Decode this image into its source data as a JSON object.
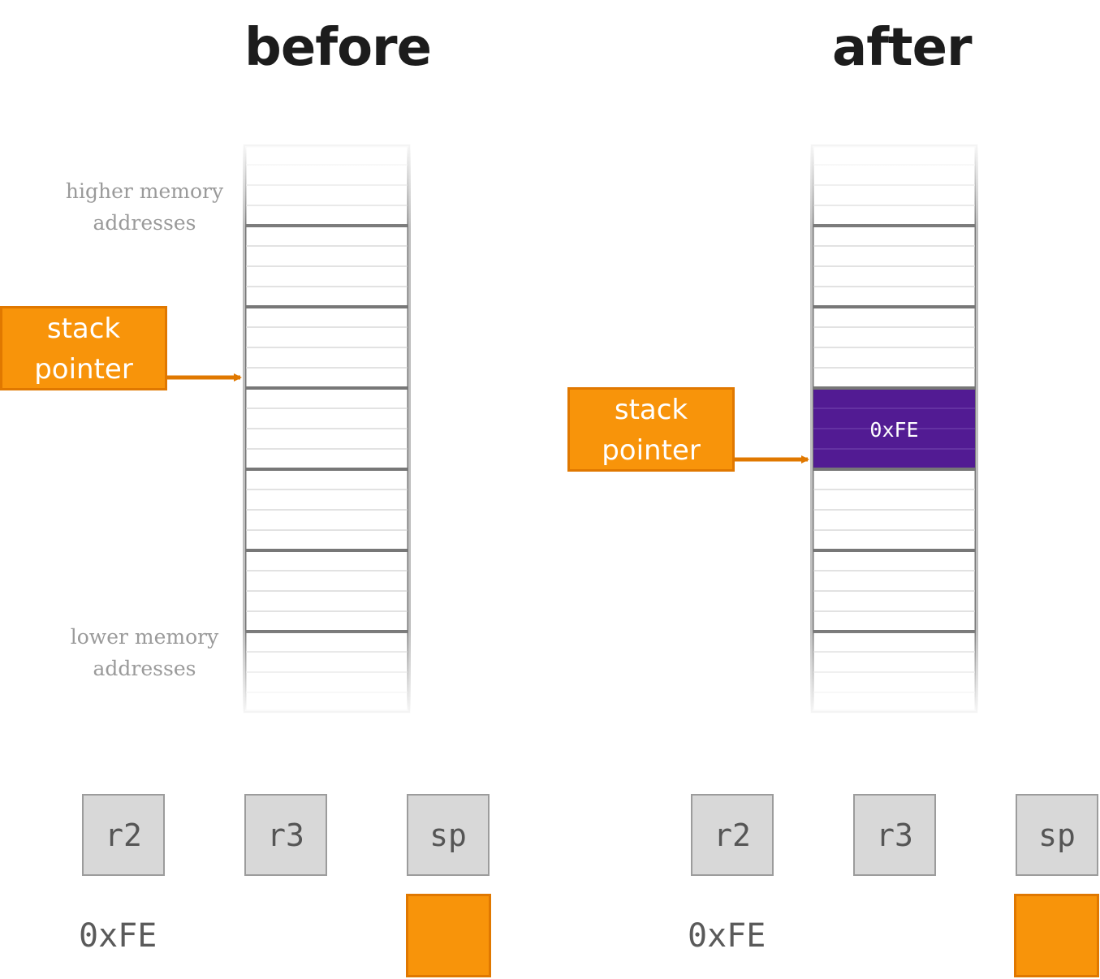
{
  "titles": {
    "before": "before",
    "after": "after"
  },
  "memory_labels": {
    "higher": [
      "higher memory",
      "addresses"
    ],
    "lower": [
      "lower memory",
      "addresses"
    ]
  },
  "stack_pointer_label": [
    "stack",
    "pointer"
  ],
  "pushed_value": "0xFE",
  "registers": {
    "names": [
      "r2",
      "r3",
      "sp"
    ],
    "before": {
      "r2": "0xFE",
      "r3": "",
      "sp": ""
    },
    "after": {
      "r2": "0xFE",
      "r3": "",
      "sp": ""
    }
  },
  "colors": {
    "stack_pointer": "#f8940a",
    "stack_pointer_border": "#e07800",
    "pushed_cell": "#521b93",
    "register_bg": "#d8d8d8"
  }
}
